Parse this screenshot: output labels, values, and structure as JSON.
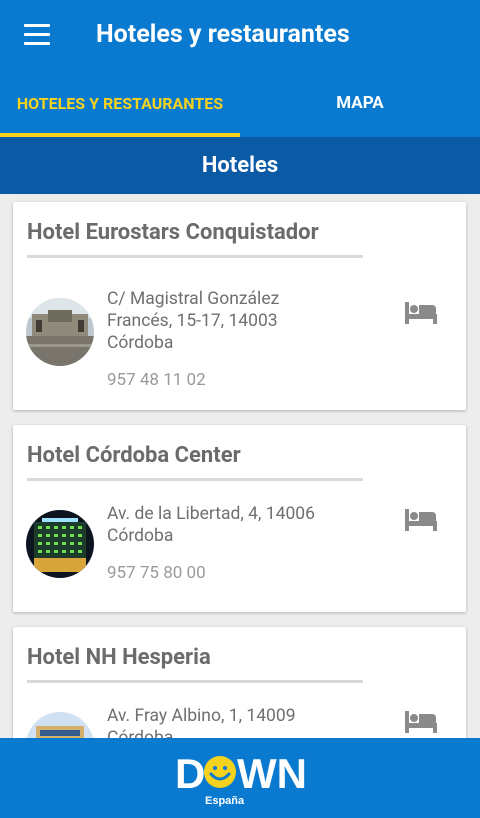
{
  "app_bar": {
    "title": "Hoteles y restaurantes",
    "menu_icon": "hamburger-menu-icon"
  },
  "tabs": [
    {
      "label": "HOTELES Y RESTAURANTES",
      "active": true
    },
    {
      "label": "MAPA",
      "active": false
    }
  ],
  "section": {
    "title": "Hoteles"
  },
  "hotels": [
    {
      "name": "Hotel Eurostars Conquistador",
      "address_lines": [
        "C/ Magistral González",
        "Francés, 15-17, 14003",
        "Córdoba"
      ],
      "phone": "957 48 11 02",
      "icon": "bed-icon"
    },
    {
      "name": "Hotel Córdoba Center",
      "address_lines": [
        "Av. de la Libertad, 4, 14006",
        "Córdoba"
      ],
      "phone": "957 75 80 00",
      "icon": "bed-icon"
    },
    {
      "name": "Hotel NH Hesperia",
      "address_lines": [
        "Av. Fray Albino, 1, 14009",
        "Córdoba"
      ],
      "phone": "",
      "icon": "bed-icon"
    }
  ],
  "footer": {
    "logo_text": "DOWN",
    "logo_subtext": "España"
  },
  "colors": {
    "app_bar": "#0a7ad0",
    "section_bar": "#0b5aa6",
    "tab_active": "#f5d21d",
    "card_title": "#6b6b6b",
    "logo_smile": "#f5d21d"
  }
}
